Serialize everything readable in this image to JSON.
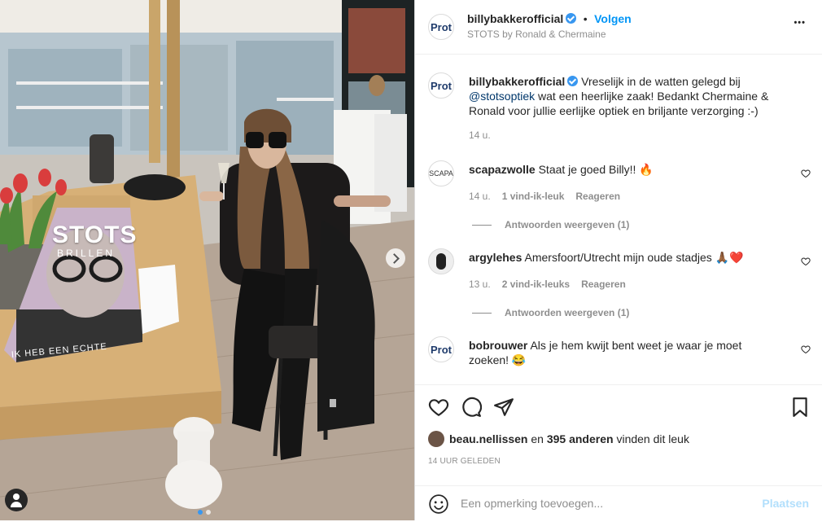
{
  "post": {
    "username": "billybakkerofficial",
    "follow_label": "Volgen",
    "location": "STOTS by Ronald & Chermaine",
    "more_label": "•••",
    "avatar_text": "Prot"
  },
  "photo": {
    "bag_brand": "STOTS",
    "bag_sub": "BRILLEN",
    "bag_slogan": "IK HEB EEN ECHTE"
  },
  "comments": [
    {
      "avatar_text": "Prot",
      "username": "billybakkerofficial",
      "text_before": " Vreselijk in de watten gelegd bij ",
      "mention": "@stotsoptiek",
      "text_after": " wat een heerlijke zaak! Bedankt Chermaine & Ronald voor jullie eerlijke optiek en briljante verzorging :-)",
      "time": "14 u."
    },
    {
      "avatar_text": "SCAPA",
      "username": "scapazwolle",
      "text": " Staat je goed Billy!! 🔥",
      "time": "14 u.",
      "likes": "1 vind-ik-leuk",
      "reply": "Reageren",
      "view_replies": "Antwoorden weergeven (1)"
    },
    {
      "username": "argylehes",
      "text": " Amersfoort/Utrecht mijn oude stadjes 🙏🏾❤️",
      "time": "13 u.",
      "likes": "2 vind-ik-leuks",
      "reply": "Reageren",
      "view_replies": "Antwoorden weergeven (1)"
    },
    {
      "avatar_text": "Prot",
      "username": "bobrouwer",
      "text": " Als je hem kwijt bent weet je waar je moet zoeken! 😂"
    }
  ],
  "likes": {
    "user": "beau.nellissen",
    "middle": " en ",
    "count": "395 anderen",
    "suffix": " vinden dit leuk"
  },
  "timestamp": "14 UUR GELEDEN",
  "comment_box": {
    "placeholder": "Een opmerking toevoegen...",
    "post_label": "Plaatsen"
  },
  "colors": {
    "accent": "#0095f6",
    "verified": "#3897f0",
    "muted": "#8e8e8e",
    "post_disabled": "#b2dffc"
  }
}
